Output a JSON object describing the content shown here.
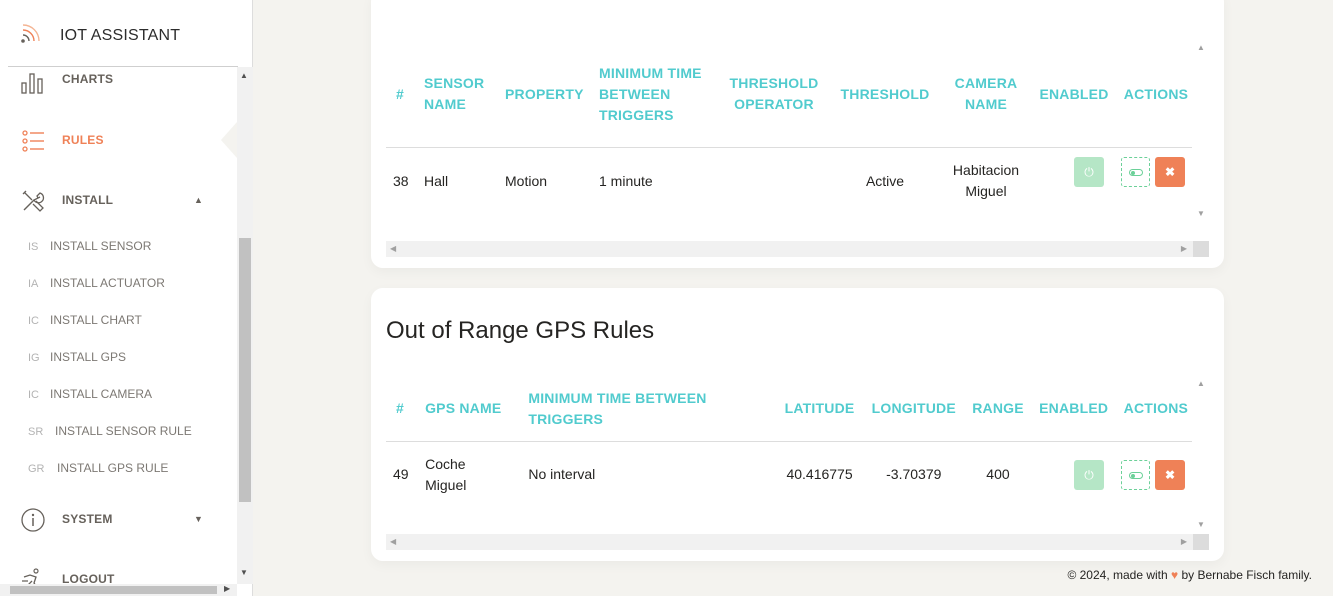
{
  "brand": {
    "title": "IOT ASSISTANT",
    "logo_icon": "wifi-signal-icon"
  },
  "nav": {
    "charts": "CHARTS",
    "rules": "RULES",
    "install": "INSTALL",
    "system": "SYSTEM",
    "logout": "LOGOUT",
    "install_items": [
      {
        "abbr": "IS",
        "label": "INSTALL SENSOR"
      },
      {
        "abbr": "IA",
        "label": "INSTALL ACTUATOR"
      },
      {
        "abbr": "IC",
        "label": "INSTALL CHART"
      },
      {
        "abbr": "IG",
        "label": "INSTALL GPS"
      },
      {
        "abbr": "IC",
        "label": "INSTALL CAMERA"
      },
      {
        "abbr": "SR",
        "label": "INSTALL SENSOR RULE"
      },
      {
        "abbr": "GR",
        "label": "INSTALL GPS RULE"
      }
    ],
    "active_color": "#ef8157"
  },
  "sensor_rules": {
    "headers": {
      "num": "#",
      "sensor_name": "SENSOR NAME",
      "property": "PROPERTY",
      "min_time": "MINIMUM TIME BETWEEN TRIGGERS",
      "threshold_operator": "THRESHOLD OPERATOR",
      "threshold": "THRESHOLD",
      "camera_name": "CAMERA NAME",
      "enabled": "ENABLED",
      "actions": "ACTIONS"
    },
    "rows": [
      {
        "num": "38",
        "sensor_name": "Hall",
        "property": "Motion",
        "min_time": "1 minute",
        "threshold_operator": "",
        "threshold": "Active",
        "camera_name": "Habitacion Miguel"
      }
    ]
  },
  "gps_rules": {
    "title": "Out of Range GPS Rules",
    "headers": {
      "num": "#",
      "gps_name": "GPS NAME",
      "min_time": "MINIMUM TIME BETWEEN TRIGGERS",
      "latitude": "LATITUDE",
      "longitude": "LONGITUDE",
      "range": "RANGE",
      "enabled": "ENABLED",
      "actions": "ACTIONS"
    },
    "rows": [
      {
        "num": "49",
        "gps_name": "Coche Miguel",
        "min_time": "No interval",
        "latitude": "40.416775",
        "longitude": "-3.70379",
        "range": "400"
      }
    ]
  },
  "footer": {
    "prefix": "© 2024, made with",
    "heart": "♥",
    "suffix": "by Bernabe Fisch family."
  },
  "colors": {
    "accent": "#51cbce",
    "danger": "#ef8157",
    "success_light": "#b5e6c6",
    "success": "#6bd098"
  }
}
